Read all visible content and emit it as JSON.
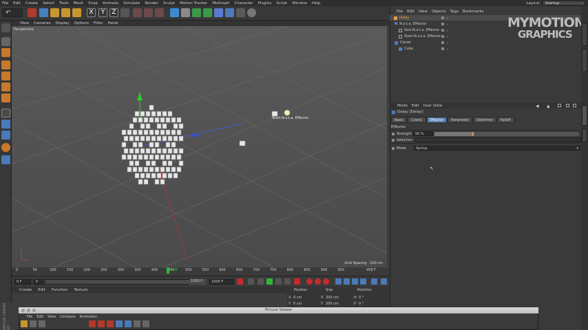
{
  "menu": [
    "File",
    "Edit",
    "Create",
    "Select",
    "Tools",
    "Mesh",
    "Snap",
    "Animate",
    "Simulate",
    "Render",
    "Sculpt",
    "Motion Tracker",
    "MoGraph",
    "Character",
    "Plugins",
    "Script",
    "Window",
    "Help"
  ],
  "layout": {
    "label": "Layout:",
    "value": "Startup"
  },
  "axis_buttons": [
    "X",
    "Y",
    "Z"
  ],
  "viewport": {
    "menu": [
      "View",
      "Cameras",
      "Display",
      "Options",
      "Filter",
      "Panel"
    ],
    "label": "Perspective",
    "grid_spacing": "Grid Spacing : 100 cm",
    "effector_label": "Start-N.o.t.a. Effector"
  },
  "timeline": {
    "ticks": [
      "0",
      "50",
      "100",
      "150",
      "200",
      "250",
      "300",
      "350",
      "400",
      "450",
      "500",
      "550",
      "600",
      "650",
      "700",
      "750",
      "800",
      "850",
      "900",
      "950"
    ],
    "marker": "458",
    "end": "458 F"
  },
  "controls": {
    "current": "0 F",
    "start": "0",
    "mid": "1000 F",
    "end": "1000 F"
  },
  "material_menu": [
    "Create",
    "Edit",
    "Function",
    "Texture"
  ],
  "coords": {
    "headers": [
      "Position",
      "Size",
      "Rotation"
    ],
    "rows": [
      {
        "a": "X",
        "pos": "0 cm",
        "b": "X",
        "size": "200 cm",
        "c": "H",
        "rot": "0 °"
      },
      {
        "a": "Y",
        "pos": "0 cm",
        "b": "Y",
        "size": "200 cm",
        "c": "P",
        "rot": "0 °"
      }
    ]
  },
  "objects": {
    "menu": [
      "File",
      "Edit",
      "View",
      "Objects",
      "Tags",
      "Bookmarks"
    ],
    "items": [
      "Delay",
      "N.o.t.a. Effector",
      "Sort-N.o.t.a. Effector",
      "Start-N.o.t.a. Effector",
      "Cloner",
      "Cube"
    ]
  },
  "logo": {
    "line1": "MYMOTION",
    "line2": "GRAPHICS"
  },
  "attributes": {
    "menu": [
      "Mode",
      "Edit",
      "User Data"
    ],
    "title": "Delay [Delay]",
    "tabs": [
      "Basic",
      "Coord.",
      "Effector",
      "Parameter",
      "Deformer",
      "Falloff"
    ],
    "section": "Effector",
    "strength_label": "Strength",
    "strength_value": "50 %",
    "strength": 0.5,
    "selection_label": "Selection",
    "mode_label": "Mode",
    "mode_value": "Spring"
  },
  "picture_viewer": {
    "title": "Picture Viewer",
    "menu": [
      "File",
      "Edit",
      "View",
      "Compare",
      "Animation"
    ]
  },
  "brand": "MAXON CINEMA 4D",
  "colors": {
    "accent": "#5a86b8",
    "active_tab": "#5a86b8",
    "selected_obj": "#e2a040",
    "play": "#2eb83a"
  }
}
